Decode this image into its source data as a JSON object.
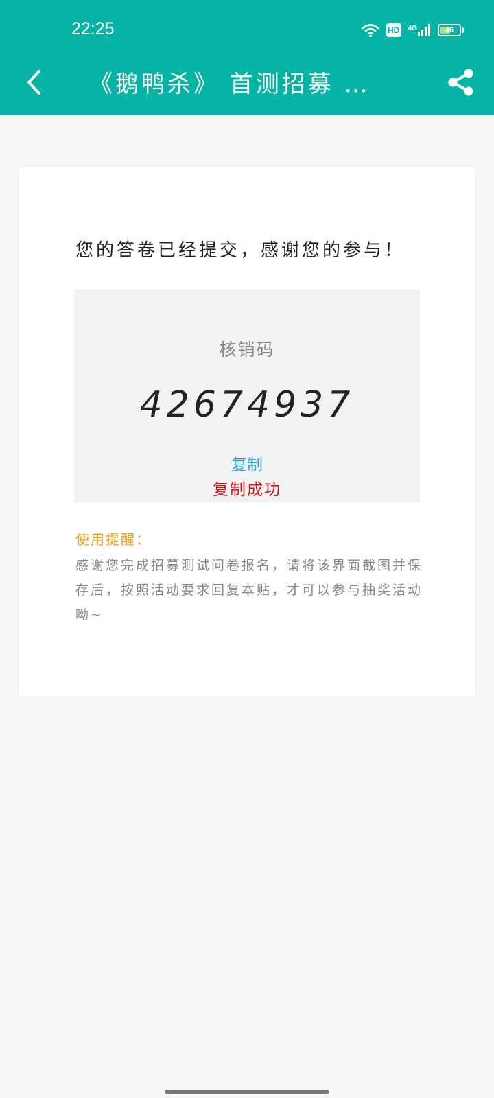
{
  "status_bar": {
    "time": "22:25",
    "hd_badge": "HD",
    "network": "4G",
    "battery_level": "46",
    "icons": [
      "wifi-icon",
      "hd-icon",
      "signal-icon",
      "battery-icon"
    ]
  },
  "header": {
    "title": "《鹅鸭杀》 首测招募 …",
    "back_icon": "chevron-left-icon",
    "share_icon": "share-icon",
    "background_color": "#06b4a6"
  },
  "card": {
    "submit_message": "您的答卷已经提交，感谢您的参与！",
    "code_label": "核销码",
    "code_value": "42674937",
    "copy_label": "复制",
    "copy_success": "复制成功",
    "tips_title": "使用提醒：",
    "tips_body": "感谢您完成招募测试问卷报名，请将该界面截图并保存后，按照活动要求回复本贴，才可以参与抽奖活动呦~"
  },
  "colors": {
    "accent": "#06b4a6",
    "link": "#2aa0d8",
    "success": "#d41515",
    "warning": "#f39c12"
  }
}
